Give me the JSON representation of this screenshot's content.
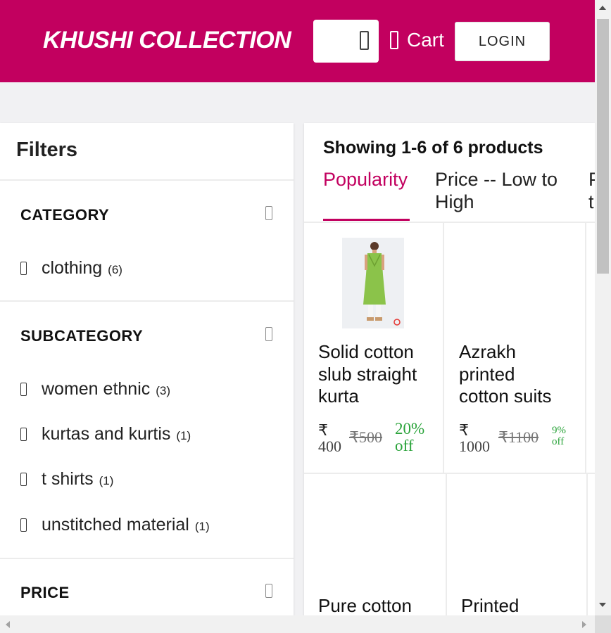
{
  "header": {
    "brand": "KHUSHI COLLECTION",
    "cart_label": "Cart",
    "login_label": "LOGIN",
    "brand_color": "#c2005f"
  },
  "filters": {
    "title": "Filters",
    "category": {
      "heading": "CATEGORY",
      "options": [
        {
          "label": "clothing",
          "count": "(6)"
        }
      ]
    },
    "subcategory": {
      "heading": "SUBCATEGORY",
      "options": [
        {
          "label": "women ethnic",
          "count": "(3)"
        },
        {
          "label": "kurtas and kurtis",
          "count": "(1)"
        },
        {
          "label": "t shirts",
          "count": "(1)"
        },
        {
          "label": "unstitched material",
          "count": "(1)"
        }
      ]
    },
    "price": {
      "heading": "PRICE"
    }
  },
  "products": {
    "showing": "Showing 1-6 of 6 products",
    "sort_tabs": [
      {
        "line1": "Popularity",
        "line2": "",
        "active": true
      },
      {
        "line1": "Price -- Low to",
        "line2": "High",
        "active": false
      },
      {
        "line1": "P",
        "line2": "t",
        "active": false
      }
    ],
    "items": [
      {
        "name_lines": [
          "Solid cotton",
          "slub straight",
          "kurta"
        ],
        "currency": "₹",
        "price": "400",
        "mrp": "₹500",
        "discount_lines": [
          "20%",
          "off"
        ]
      },
      {
        "name_lines": [
          "Azrakh",
          "printed",
          "cotton suits"
        ],
        "currency": "₹",
        "price": "1000",
        "mrp": "₹1100",
        "discount_lines": [
          "9%",
          "off"
        ]
      },
      {
        "name_lines": [
          "Pure cotton"
        ]
      },
      {
        "name_lines": [
          "Printed"
        ]
      }
    ]
  }
}
